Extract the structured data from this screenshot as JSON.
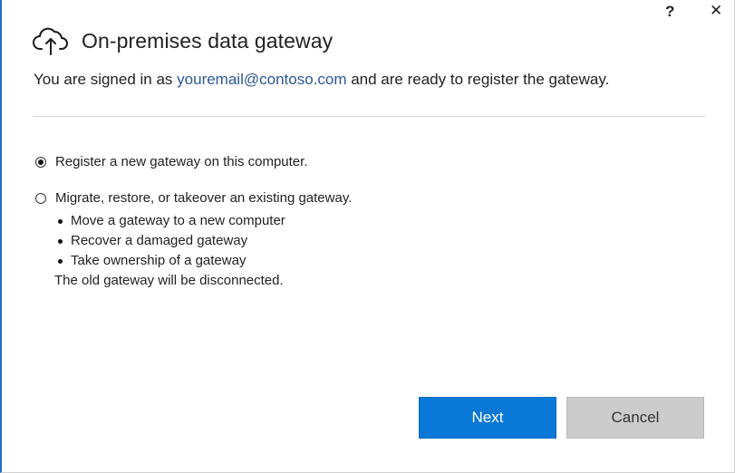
{
  "window": {
    "help_label": "?",
    "close_label": "✕"
  },
  "header": {
    "icon": "cloud-upload-icon",
    "title": "On-premises data gateway"
  },
  "signin": {
    "prefix": "You are signed in as ",
    "email": "youremail@contoso.com",
    "suffix": " and are ready to register the gateway."
  },
  "options": [
    {
      "label": "Register a new gateway on this computer.",
      "selected": true
    },
    {
      "label": "Migrate, restore, or takeover an existing gateway.",
      "selected": false
    }
  ],
  "migrate_details": {
    "bullets": [
      "Move a gateway to a new computer",
      "Recover a damaged gateway",
      "Take ownership of a gateway"
    ],
    "note": "The old gateway will be disconnected."
  },
  "buttons": {
    "next": "Next",
    "cancel": "Cancel"
  },
  "colors": {
    "accent": "#0a78d7",
    "email_link": "#2b579a",
    "window_border": "#1e73c8"
  }
}
